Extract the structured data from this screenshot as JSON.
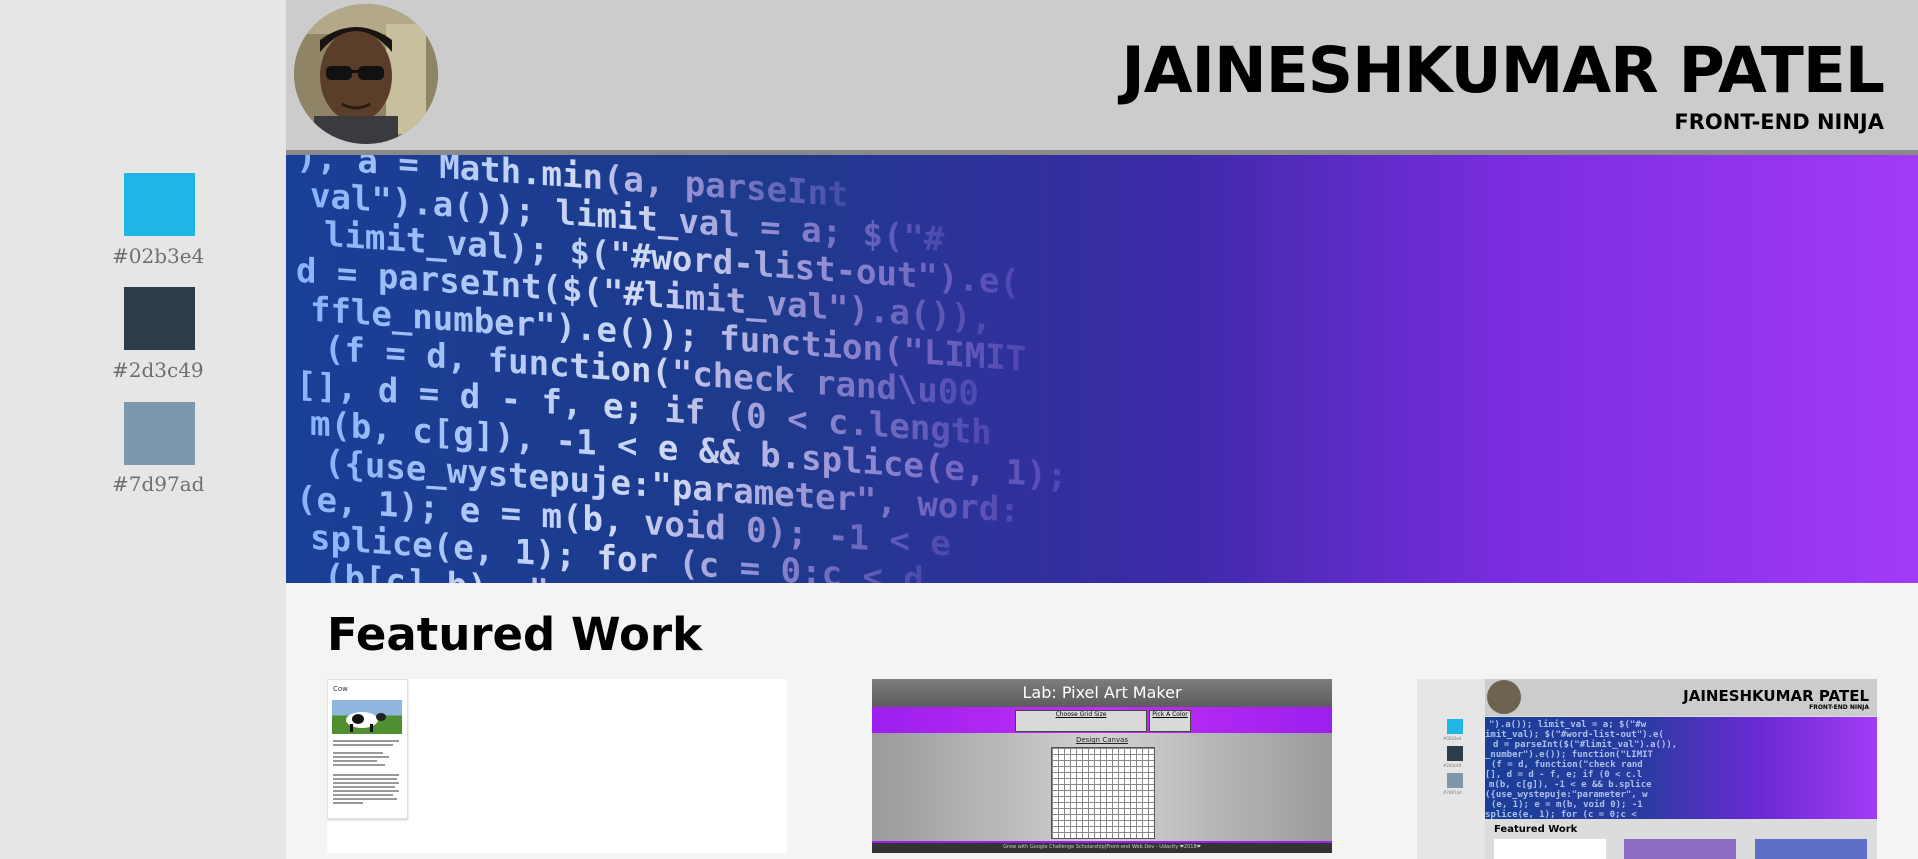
{
  "sidebar": {
    "swatches": [
      {
        "color": "#1fb6e6",
        "label": "#02b3e4"
      },
      {
        "color": "#2d3c49",
        "label": "#2d3c49"
      },
      {
        "color": "#7d97ad",
        "label": "#7d97ad"
      }
    ]
  },
  "header": {
    "name": "JAINESHKUMAR PATEL",
    "tagline": "FRONT-END NINJA",
    "avatar_icon": "profile-photo"
  },
  "hero": {
    "code_lines": [
      "), a = Math.min(a, parseInt",
      "val\").a()); limit_val = a; $(\"#",
      "limit_val); $(\"#word-list-out\").e(",
      "d = parseInt($(\"#limit_val\").a()),",
      "ffle_number\").e()); function(\"LIMIT",
      "(f = d, function(\"check rand\\u00",
      "[], d = d - f, e; if (0 < c.length",
      "m(b, c[g]), -1 < e && b.splice(e, 1);",
      "({use_wystepuje:\"parameter\", word:",
      "(e, 1); e = m(b, void 0); -1 < e",
      "splice(e, 1); for (c = 0;c < d",
      "(b[c].b), \"paramet"
    ]
  },
  "featured": {
    "title": "Featured Work",
    "cards": [
      {
        "doc_title": "Cow"
      },
      {
        "title": "Lab: Pixel Art Maker",
        "choose_grid": "Choose Grid Size",
        "pick_color": "Pick A Color",
        "canvas_label": "Design Canvas",
        "footer": "Grow with Google Challenge Scholarship|Front-end Web Dev - Udacity ❤2018❤"
      },
      {
        "name": "JAINESHKUMAR PATEL",
        "tagline": "FRONT-END NINJA",
        "featured": "Featured Work",
        "swatches": [
          "#02b3e4",
          "#2d3c49",
          "#7d97ad"
        ]
      }
    ]
  }
}
